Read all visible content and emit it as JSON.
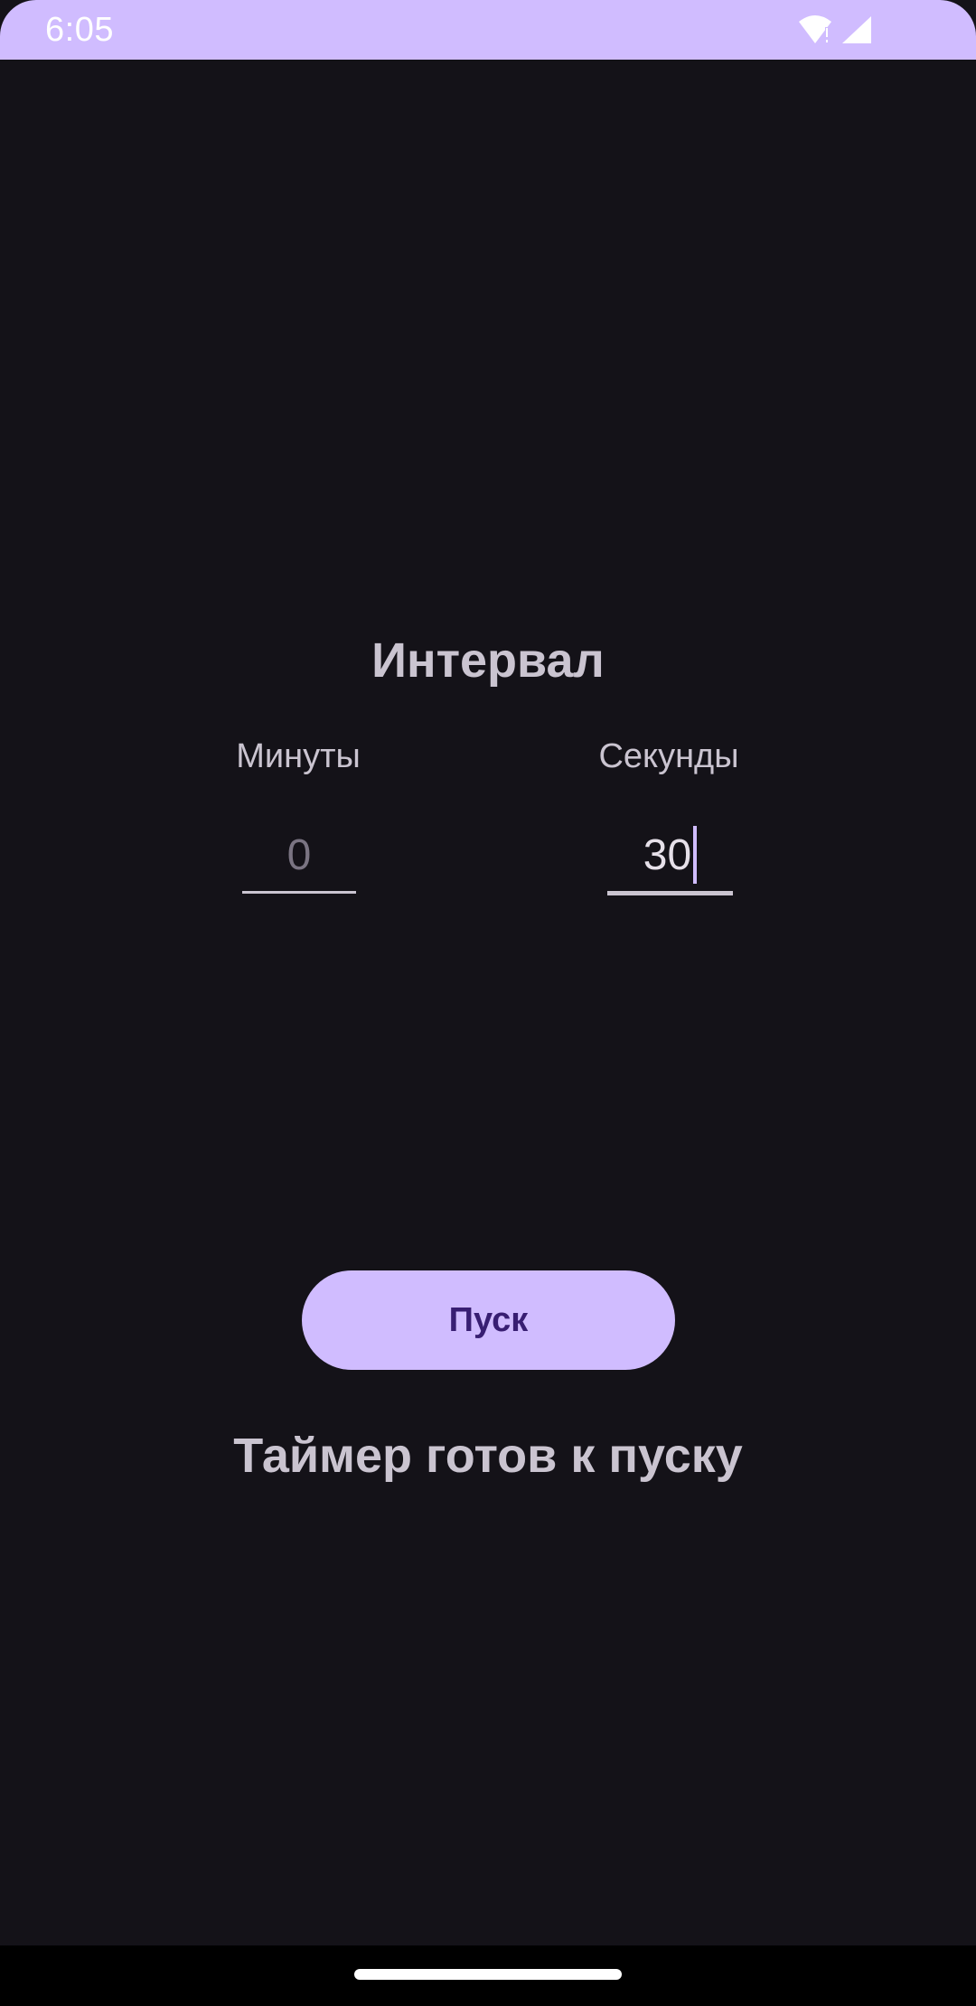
{
  "status_bar": {
    "time": "6:05",
    "icons": [
      "wifi-alert-icon",
      "signal-icon"
    ],
    "color": "#d0bcff"
  },
  "main": {
    "title": "Интервал",
    "minutes": {
      "label": "Минуты",
      "placeholder": "0",
      "value": ""
    },
    "seconds": {
      "label": "Секунды",
      "value": "30"
    },
    "start_button": "Пуск",
    "status_message": "Таймер готов к пуску"
  },
  "colors": {
    "background": "#141218",
    "accent": "#d0bcff",
    "on_accent": "#381e72",
    "text": "#cac4d0"
  }
}
